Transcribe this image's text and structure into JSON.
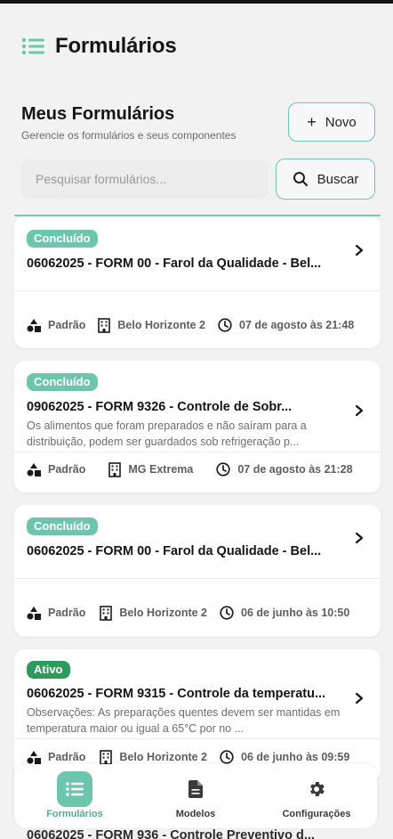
{
  "header": {
    "title": "Formulários"
  },
  "section": {
    "title": "Meus Formulários",
    "subtitle": "Gerencie os formulários e seus componentes"
  },
  "actions": {
    "new_label": "Novo",
    "search_placeholder": "Pesquisar formulários...",
    "search_button": "Buscar"
  },
  "colors": {
    "accent": "#6cc6ae",
    "active_badge": "#2e9a5c",
    "background": "#f2f2f2"
  },
  "forms": [
    {
      "status": "Concluído",
      "title": "06062025 - FORM 00 - Farol da Qualidade - Bel...",
      "description": "",
      "type": "Padrão",
      "unit": "Belo Horizonte 2",
      "date": "07 de agosto às 21:48"
    },
    {
      "status": "Concluído",
      "title": "09062025  - FORM 9326 - Controle de Sobr...",
      "description": "Os alimentos que foram preparados e não saíram para a distribuição, podem ser guardados sob refrigeração p...",
      "type": "Padrão",
      "unit": "MG Extrema",
      "date": "07 de agosto às 21:28"
    },
    {
      "status": "Concluído",
      "title": "06062025 - FORM 00 - Farol da Qualidade - Bel...",
      "description": "",
      "type": "Padrão",
      "unit": "Belo Horizonte 2",
      "date": "06 de junho às 10:50"
    },
    {
      "status": "Ativo",
      "title": "06062025 - FORM 9315 - Controle da temperatu...",
      "description": "Observações: As preparações quentes devem ser mantidas em temperatura maior ou igual a 65°C por no ...",
      "type": "Padrão",
      "unit": "Belo Horizonte 2",
      "date": "06 de junho às 09:59"
    }
  ],
  "peek_title": "06062025 - FORM 936 - Controle Preventivo d...",
  "nav": [
    {
      "label": "Formulários",
      "icon": "list-icon",
      "active": true
    },
    {
      "label": "Modelos",
      "icon": "document-icon",
      "active": false
    },
    {
      "label": "Configurações",
      "icon": "gear-icon",
      "active": false
    }
  ]
}
